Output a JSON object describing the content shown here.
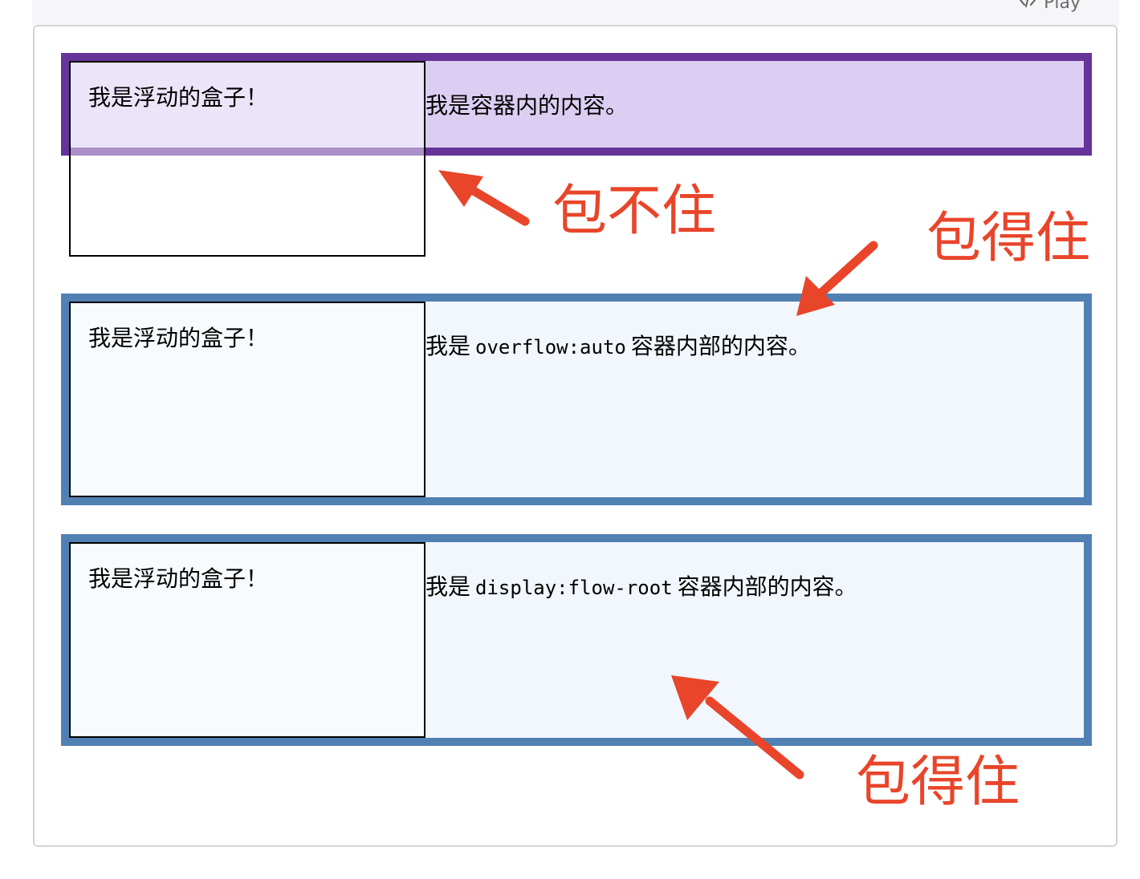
{
  "toolbar": {
    "play_label": "Play",
    "play_icon": "code-icon"
  },
  "examples": [
    {
      "float_text": "我是浮动的盒子！",
      "content_prefix": "我是容器内的内容。",
      "content_code": "",
      "content_suffix": ""
    },
    {
      "float_text": "我是浮动的盒子！",
      "content_prefix": "我是",
      "content_code": "overflow:auto",
      "content_suffix": "容器内部的内容。"
    },
    {
      "float_text": "我是浮动的盒子！",
      "content_prefix": "我是",
      "content_code": "display:flow-root",
      "content_suffix": "容器内部的内容。"
    }
  ],
  "annotations": {
    "not_contained": "包不住",
    "contained_1": "包得住",
    "contained_2": "包得住"
  },
  "colors": {
    "purple_border": "#663399",
    "purple_bg": "#dccef2",
    "blue_border": "#5180b3",
    "blue_bg": "#f1f7fd",
    "annotation_red": "#e8452a"
  }
}
